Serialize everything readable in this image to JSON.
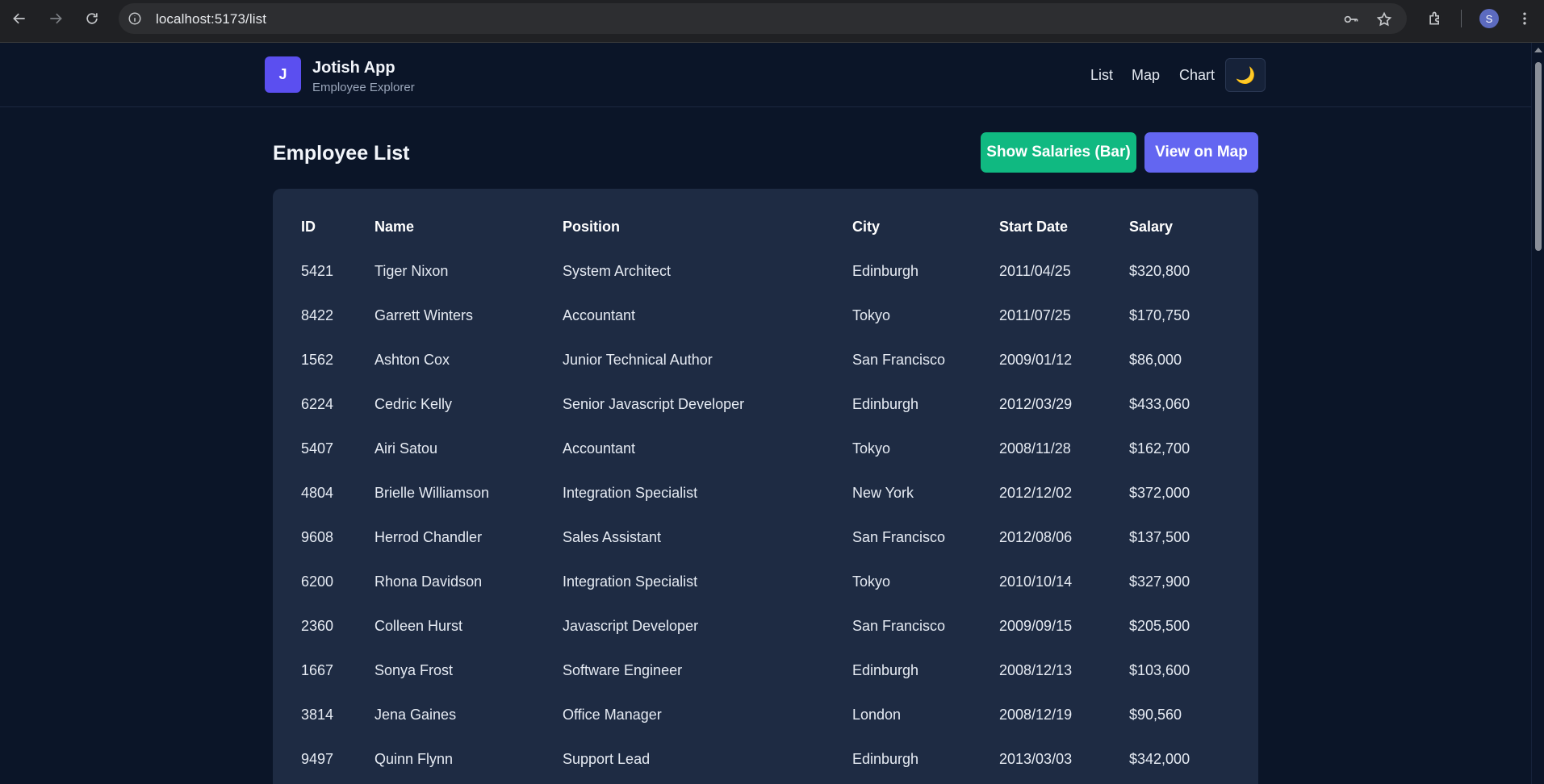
{
  "browser": {
    "url": "localhost:5173/list",
    "profile_initial": "S"
  },
  "app": {
    "logo_letter": "J",
    "title": "Jotish App",
    "subtitle": "Employee Explorer",
    "nav": [
      "List",
      "Map",
      "Chart"
    ],
    "theme_icon": "🌙"
  },
  "page": {
    "title": "Employee List",
    "show_salaries_label": "Show Salaries (Bar)",
    "view_map_label": "View on Map"
  },
  "table": {
    "headers": [
      "ID",
      "Name",
      "Position",
      "City",
      "Start Date",
      "Salary"
    ],
    "rows": [
      [
        "5421",
        "Tiger Nixon",
        "System Architect",
        "Edinburgh",
        "2011/04/25",
        "$320,800"
      ],
      [
        "8422",
        "Garrett Winters",
        "Accountant",
        "Tokyo",
        "2011/07/25",
        "$170,750"
      ],
      [
        "1562",
        "Ashton Cox",
        "Junior Technical Author",
        "San Francisco",
        "2009/01/12",
        "$86,000"
      ],
      [
        "6224",
        "Cedric Kelly",
        "Senior Javascript Developer",
        "Edinburgh",
        "2012/03/29",
        "$433,060"
      ],
      [
        "5407",
        "Airi Satou",
        "Accountant",
        "Tokyo",
        "2008/11/28",
        "$162,700"
      ],
      [
        "4804",
        "Brielle Williamson",
        "Integration Specialist",
        "New York",
        "2012/12/02",
        "$372,000"
      ],
      [
        "9608",
        "Herrod Chandler",
        "Sales Assistant",
        "San Francisco",
        "2012/08/06",
        "$137,500"
      ],
      [
        "6200",
        "Rhona Davidson",
        "Integration Specialist",
        "Tokyo",
        "2010/10/14",
        "$327,900"
      ],
      [
        "2360",
        "Colleen Hurst",
        "Javascript Developer",
        "San Francisco",
        "2009/09/15",
        "$205,500"
      ],
      [
        "1667",
        "Sonya Frost",
        "Software Engineer",
        "Edinburgh",
        "2008/12/13",
        "$103,600"
      ],
      [
        "3814",
        "Jena Gaines",
        "Office Manager",
        "London",
        "2008/12/19",
        "$90,560"
      ],
      [
        "9497",
        "Quinn Flynn",
        "Support Lead",
        "Edinburgh",
        "2013/03/03",
        "$342,000"
      ]
    ]
  },
  "colors": {
    "background": "#0b1528",
    "card": "#1e2b43",
    "accent_green": "#10b981",
    "accent_purple": "#6366f1",
    "logo": "#5b4ff0"
  }
}
